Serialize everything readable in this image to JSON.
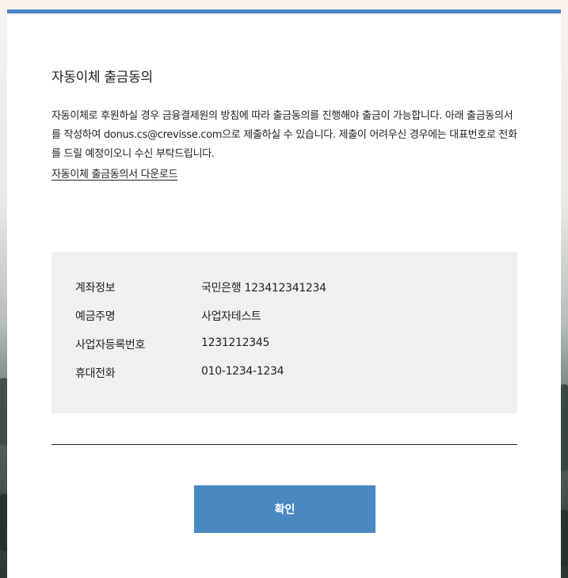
{
  "dialog": {
    "title": "자동이체 출금동의",
    "description": "자동이체로 후원하실 경우 금융결제원의 방침에 따라 출금동의를 진행해야 출금이 가능합니다. 아래 출금동의서를 작성하여 donus.cs@crevisse.com으로 제출하실 수 있습니다. 제출이 어려우신 경우에는 대표번호로 전화를 드릴 예정이오니 수신 부탁드립니다.",
    "download_link": "자동이체 출금동의서 다운로드",
    "confirm_label": "확인"
  },
  "info": {
    "rows": [
      {
        "label": "계좌정보",
        "value": "국민은행 123412341234"
      },
      {
        "label": "예금주명",
        "value": "사업자테스트"
      },
      {
        "label": "사업자등록번호",
        "value": "1231212345"
      },
      {
        "label": "휴대전화",
        "value": "010-1234-1234"
      }
    ]
  },
  "colors": {
    "accent": "#4a88c2",
    "info_background": "#f0f0f0"
  }
}
